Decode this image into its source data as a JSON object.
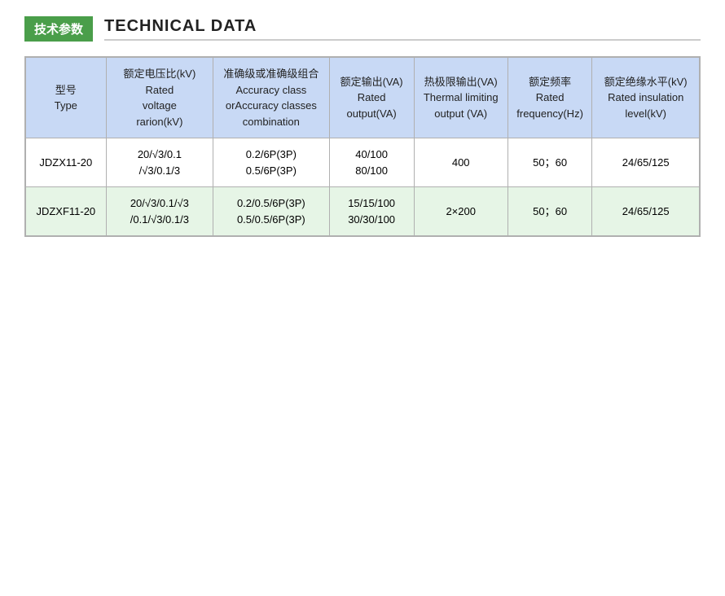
{
  "header": {
    "badge": "技术参数",
    "title": "TECHNICAL DATA"
  },
  "table": {
    "columns": [
      {
        "id": "type",
        "line1": "型号",
        "line2": "Type"
      },
      {
        "id": "voltage",
        "line1": "额定电压比(kV)",
        "line2": "Rated",
        "line3": "voltage",
        "line4": "rarion(kV)"
      },
      {
        "id": "accuracy",
        "line1": "准确级或准确级组合",
        "line2": "Accuracy class",
        "line3": "orAccuracy classes",
        "line4": "combination"
      },
      {
        "id": "output",
        "line1": "额定输出(VA)",
        "line2": "Rated",
        "line3": "output(VA)"
      },
      {
        "id": "thermal",
        "line1": "热极限输出(VA)",
        "line2": "Thermal limiting",
        "line3": "output  (VA)"
      },
      {
        "id": "frequency",
        "line1": "额定频率",
        "line2": "Rated",
        "line3": "frequency(Hz)"
      },
      {
        "id": "insulation",
        "line1": "额定绝缘水平(kV)",
        "line2": "Rated insulation",
        "line3": "level(kV)"
      }
    ],
    "rows": [
      {
        "type": "JDZX11-20",
        "voltage": "20/√3/0.1\n/√3/0.1/3",
        "accuracy": "0.2/6P(3P)\n0.5/6P(3P)",
        "output": "40/100\n80/100",
        "thermal": "400",
        "frequency": "50；60",
        "insulation": "24/65/125",
        "bg": "white"
      },
      {
        "type": "JDZXF11-20",
        "voltage": "20/√3/0.1/√3\n/0.1/√3/0.1/3",
        "accuracy": "0.2/0.5/6P(3P)\n0.5/0.5/6P(3P)",
        "output": "15/15/100\n30/30/100",
        "thermal": "2×200",
        "frequency": "50；60",
        "insulation": "24/65/125",
        "bg": "green"
      }
    ]
  }
}
